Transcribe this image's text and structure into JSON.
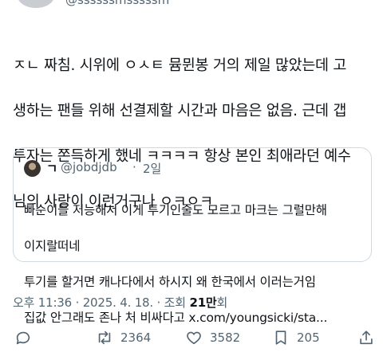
{
  "tweet": {
    "text_line1": "ㅈㄴ 짜침. 시위에 ㅇㅅㅌ 뮴뮌봉 거의 제일 많았는데 고",
    "text_line2": "생하는 팬들 위해 선결제할 시간과 마음은 없음. 근데 갭",
    "text_line3": "투자는 쫀득하게 했네 ㅋㅋㅋㅋ 항상 본인 최애라던 예수",
    "text_line4": "님의 사랑이 이런거구나 ㅇㅋㅇㅋ"
  },
  "quote": {
    "name": "ㄱ",
    "handle": "@jobdjdb",
    "separator": "·",
    "time": "2일",
    "body_line1": "빠순이들 저능해서 이게 투기인줄도 모르고 마크는 그럴만해",
    "body_line2": "이지랄떠네",
    "body_line3": "투기를 할거면 캐나다에서 하시지 왜 한국에서 이러는거임",
    "body_line4": "집값 안그래도 존나 처 비싸다고 x.com/youngsicki/sta..."
  },
  "meta": {
    "time": "오후 11:36",
    "sep1": " · ",
    "date": "2025. 4. 18.",
    "sep2": " · 조회 ",
    "views": "21만",
    "views_suffix": "회"
  },
  "actions": {
    "replies_icon": "retweet-icon",
    "retweets": "2364",
    "likes": "3582",
    "bookmarks": "205",
    "share_icon": "share-icon"
  },
  "colors": {
    "text": "#0f1419",
    "secondary": "#536471",
    "border": "#cfd9de"
  }
}
